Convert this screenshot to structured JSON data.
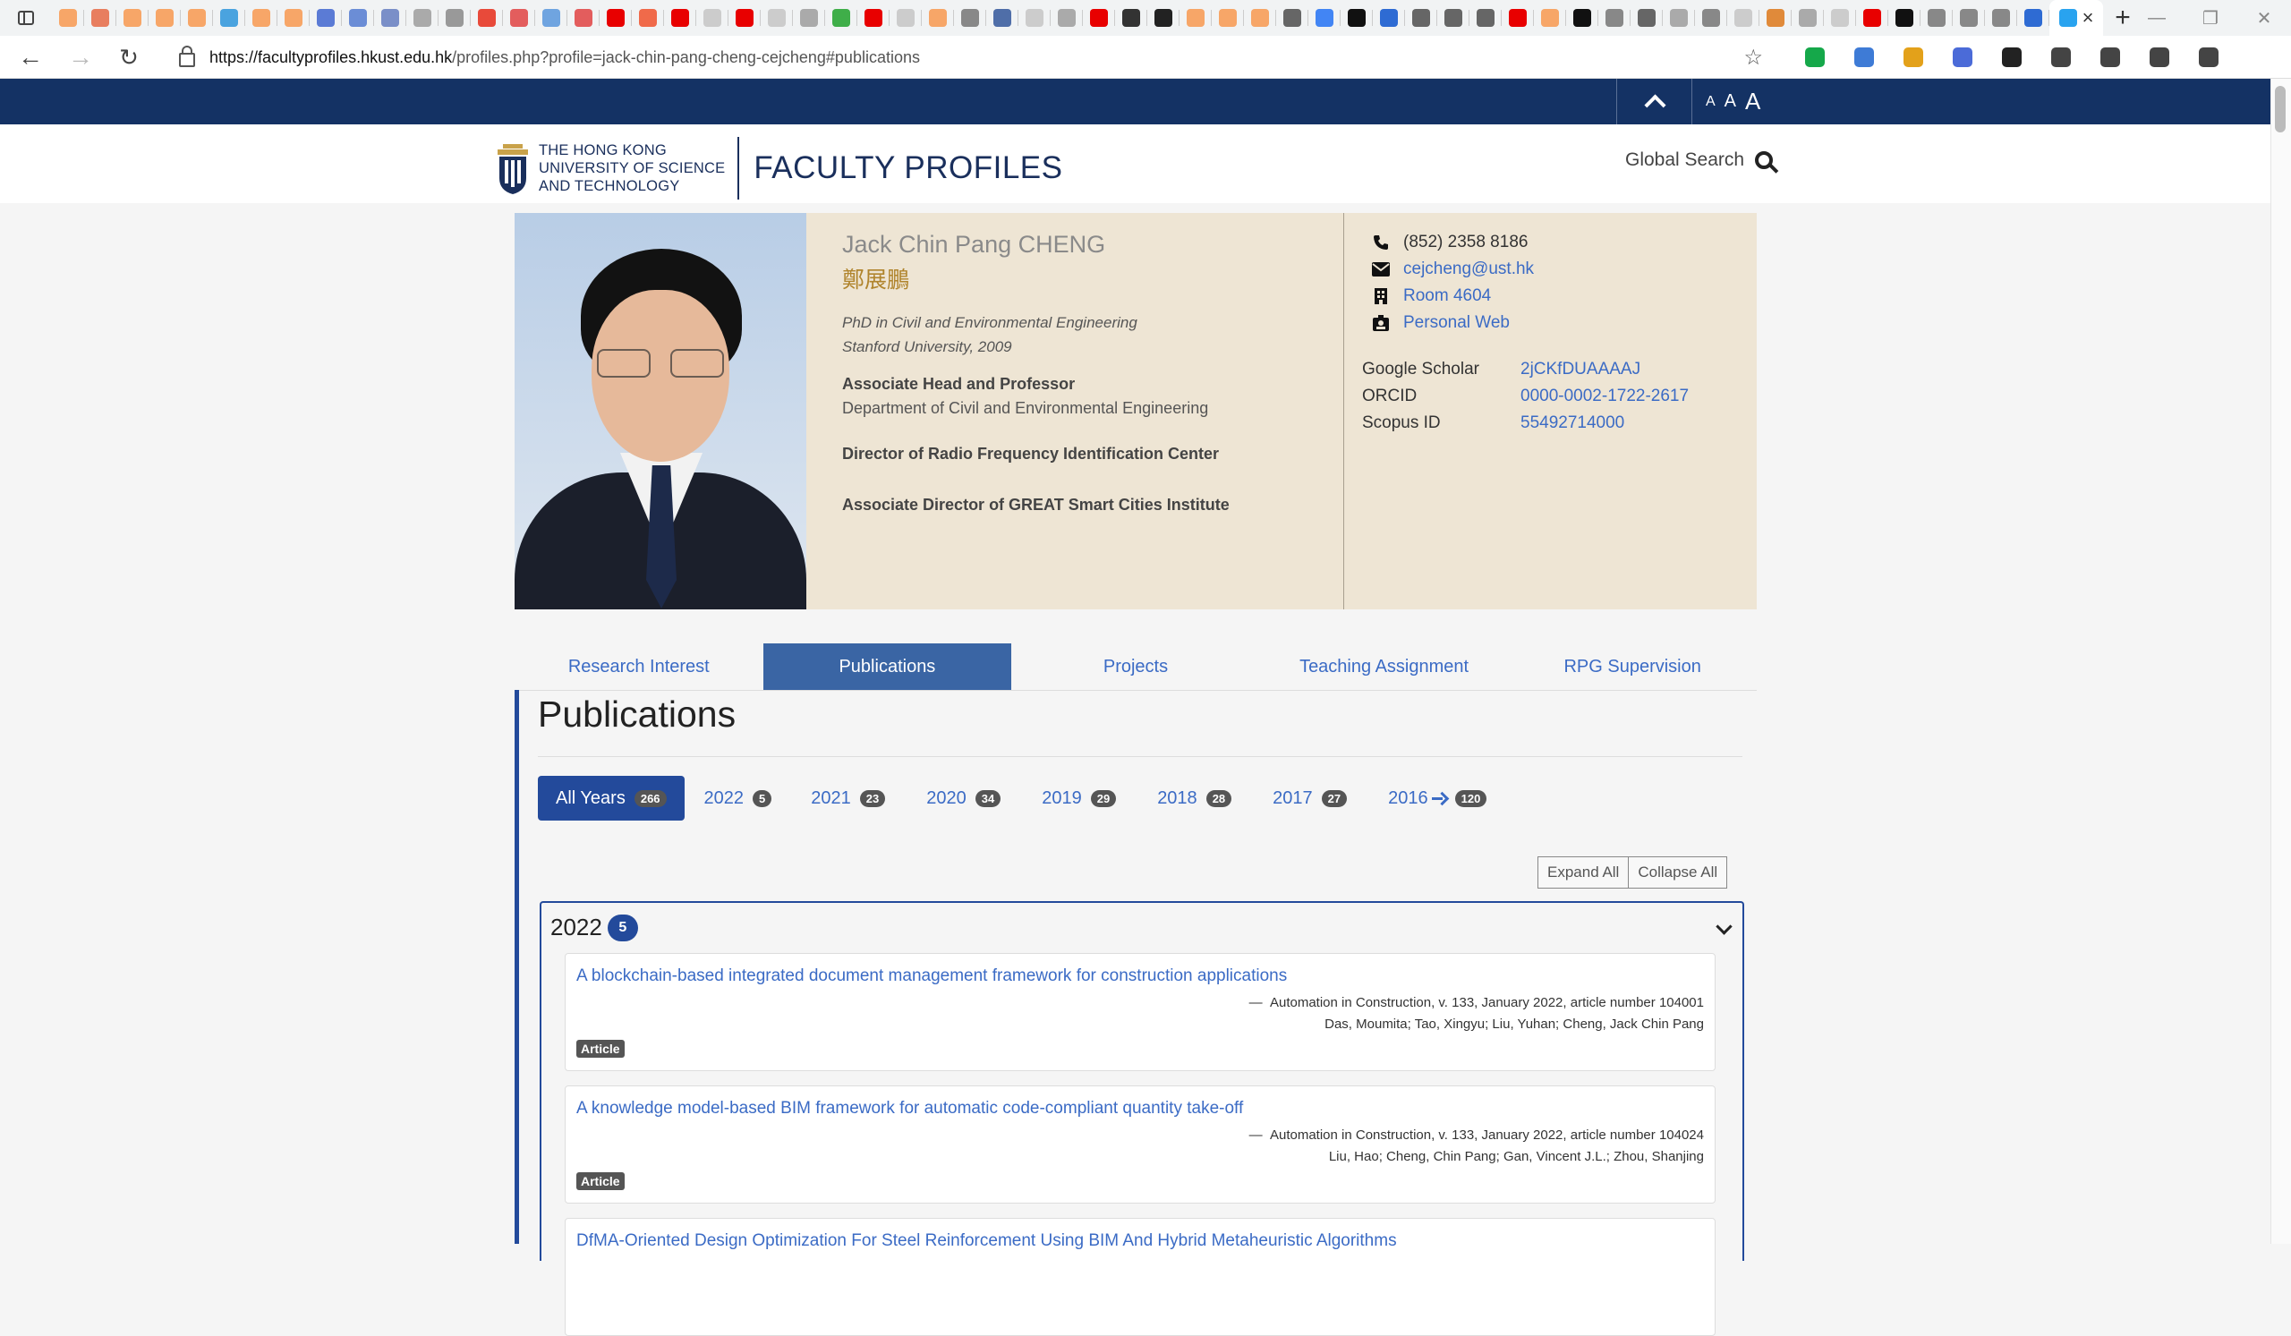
{
  "browser": {
    "favicon_colors": [
      "#f7a668",
      "#e87e5f",
      "#f7a668",
      "#f7a668",
      "#f7a668",
      "#4aa3df",
      "#f7a668",
      "#f7a668",
      "#5b7bd5",
      "#6b8dd6",
      "#7a8fc8",
      "#aaaaaa",
      "#999999",
      "#e84a3a",
      "#e35d5d",
      "#6fa4e0",
      "#e35d5d",
      "#e80000",
      "#f06a4a",
      "#e80000",
      "#cccccc",
      "#e80000",
      "#cccccc",
      "#aaaaaa",
      "#3fae49",
      "#e80000",
      "#cccccc",
      "#f7a668",
      "#888888",
      "#4f6ea8",
      "#cccccc",
      "#aaaaaa",
      "#e80000",
      "#333333",
      "#222222",
      "#f7a668",
      "#f7a668",
      "#f7a668",
      "#666666",
      "#4285f4",
      "#111111",
      "#2e6bd3",
      "#666666",
      "#666666",
      "#666666",
      "#e80000",
      "#f7a668",
      "#111111",
      "#888888",
      "#666666",
      "#aaaaaa",
      "#888888",
      "#cccccc",
      "#e08a3a",
      "#aaaaaa",
      "#cccccc",
      "#e80000",
      "#111111",
      "#888888",
      "#888888",
      "#888888",
      "#2e6bd3",
      "#29a3ef"
    ],
    "url_host": "https://facultyprofiles.hkust.edu.hk",
    "url_rest": "/profiles.php?profile=jack-chin-pang-cheng-cejcheng#publications",
    "ext_colors": [
      "#15a84a",
      "#3e7bd6",
      "#e3a11a",
      "#4b6bd8",
      "#222222",
      "#444444",
      "#444444",
      "#444444",
      "#444444"
    ]
  },
  "site": {
    "font_sizes": [
      "A",
      "A",
      "A"
    ],
    "logo_lines": [
      "THE HONG KONG",
      "UNIVERSITY OF SCIENCE",
      "AND TECHNOLOGY"
    ],
    "site_title": "FACULTY PROFILES",
    "global_search": "Global Search"
  },
  "profile": {
    "name_en": "Jack Chin Pang CHENG",
    "name_zh": "鄭展鵬",
    "degree_line1": "PhD in Civil and Environmental Engineering",
    "degree_line2": "Stanford University, 2009",
    "position": "Associate Head and Professor",
    "department": "Department of Civil and Environmental Engineering",
    "role1": "Director of Radio Frequency Identification Center",
    "role2": "Associate Director of GREAT Smart Cities Institute",
    "phone": "(852) 2358 8186",
    "email": "cejcheng@ust.hk",
    "room": "Room 4604",
    "web": "Personal Web",
    "ids": [
      {
        "label": "Google Scholar",
        "value": "2jCKfDUAAAAJ"
      },
      {
        "label": "ORCID",
        "value": "0000-0002-1722-2617"
      },
      {
        "label": "Scopus ID",
        "value": "55492714000"
      }
    ]
  },
  "tabs": [
    "Research Interest",
    "Publications",
    "Projects",
    "Teaching Assignment",
    "RPG Supervision"
  ],
  "publications": {
    "heading": "Publications",
    "years": [
      {
        "label": "All Years",
        "count": "266"
      },
      {
        "label": "2022",
        "count": "5"
      },
      {
        "label": "2021",
        "count": "23"
      },
      {
        "label": "2020",
        "count": "34"
      },
      {
        "label": "2019",
        "count": "29"
      },
      {
        "label": "2018",
        "count": "28"
      },
      {
        "label": "2017",
        "count": "27"
      },
      {
        "label": "2016",
        "count": "120"
      }
    ],
    "expand_all": "Expand All",
    "collapse_all": "Collapse All",
    "group_year": "2022",
    "group_count": "5",
    "items": [
      {
        "title": "A blockchain-based integrated document management framework for construction applications",
        "source": "Automation in Construction, v. 133, January 2022, article number 104001",
        "authors": "Das, Moumita; Tao, Xingyu; Liu, Yuhan; Cheng, Jack Chin Pang",
        "type": "Article"
      },
      {
        "title": "A knowledge model-based BIM framework for automatic code-compliant quantity take-off",
        "source": "Automation in Construction, v. 133, January 2022, article number 104024",
        "authors": "Liu, Hao; Cheng, Chin Pang; Gan, Vincent J.L.; Zhou, Shanjing",
        "type": "Article"
      },
      {
        "title": "DfMA-Oriented Design Optimization For Steel Reinforcement Using BIM And Hybrid Metaheuristic Algorithms",
        "source": "",
        "authors": "",
        "type": ""
      }
    ]
  }
}
